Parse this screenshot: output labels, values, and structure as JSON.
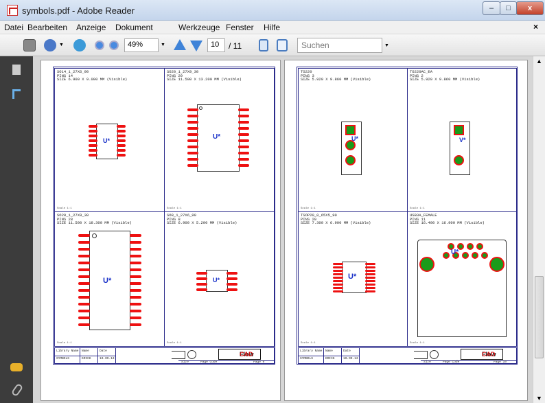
{
  "window": {
    "title": "symbols.pdf - Adobe Reader",
    "min_label": "–",
    "max_label": "□",
    "close_label": "x"
  },
  "menu": {
    "items": [
      "Datei",
      "Bearbeiten",
      "Anzeige",
      "Dokument",
      "Werkzeuge",
      "Fenster",
      "Hilfe"
    ],
    "close_label": "×"
  },
  "toolbar": {
    "zoom": "49%",
    "page_current": "10",
    "page_total": "/ 11",
    "search_placeholder": "Suchen"
  },
  "scroll": {
    "up": "▲",
    "down": "▼"
  },
  "pages": [
    {
      "cells": [
        {
          "name": "SO14_1_27X6_90",
          "pins": "PINS 14",
          "size": "SIZE 6.900 X 9.000 MM (Visible)",
          "scale": "Scale 1:1"
        },
        {
          "name": "SO20_1_27X9_30",
          "pins": "PINS 20",
          "size": "SIZE 11.500 X 13.200 MM (Visible)",
          "scale": "Scale 1:1"
        },
        {
          "name": "SO28_1_27X9_30",
          "pins": "PINS 28",
          "size": "SIZE 11.500 X 18.300 MM (Visible)",
          "scale": "Scale 1:1"
        },
        {
          "name": "SO8_1_27X6_90",
          "pins": "PINS 8",
          "size": "SIZE 6.900 X 5.200 MM (Visible)",
          "scale": "Scale 1:1"
        }
      ],
      "footer": {
        "lib_h": "Library Name",
        "lib_v": "SYMBOLS",
        "name_h": "Name",
        "name_v": "KRICK",
        "date_h": "Date",
        "date_v": "10.09.13",
        "size_h": "Size",
        "code_h": "Page Code",
        "page_v": "Page 9"
      }
    },
    {
      "cells": [
        {
          "name": "TO220",
          "pins": "PINS 3",
          "size": "SIZE 5.920 X 9.860 MM (Visible)",
          "scale": "Scale 1:1"
        },
        {
          "name": "TO220AC_EA",
          "pins": "PINS 2",
          "size": "SIZE 5.920 X 9.860 MM (Visible)",
          "scale": "Scale 1:1"
        },
        {
          "name": "TSOP20_0_65X5_90",
          "pins": "PINS 20",
          "size": "SIZE 7.300 X 6.900 MM (Visible)",
          "scale": "Scale 1:1"
        },
        {
          "name": "USB3A_FEMALE",
          "pins": "PINS 11",
          "size": "SIZE 16.400 X 16.900 MM (Visible)",
          "scale": "Scale 1:1"
        }
      ],
      "footer": {
        "lib_h": "Library Name",
        "lib_v": "SYMBOLS",
        "name_h": "Name",
        "name_v": "KRICK",
        "date_h": "Date",
        "date_v": "10.09.13",
        "size_h": "Size",
        "code_h": "Page Code",
        "page_v": "Page 10"
      }
    }
  ],
  "logo": {
    "part1": "Flow",
    "part2": "CAD"
  },
  "symbols": {
    "u_label": "U*",
    "v_label": "V*"
  },
  "colors": {
    "pad": "#ee1111",
    "accent_green": "#1a9b1a",
    "frame": "#2a2a8a",
    "label_blue": "#1830c8"
  }
}
